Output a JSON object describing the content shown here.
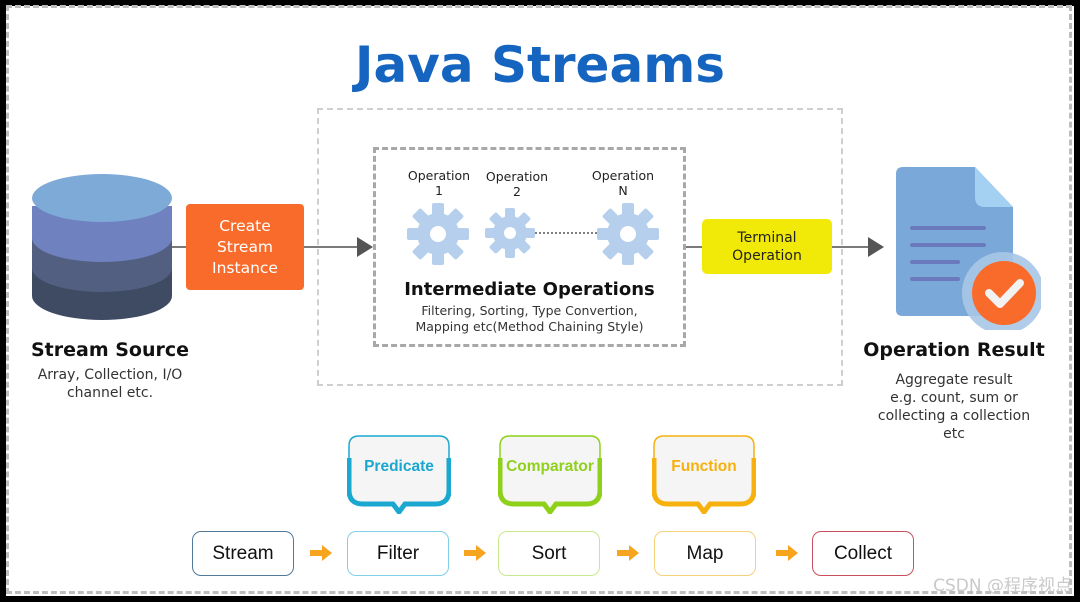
{
  "title": "Java Streams",
  "colors": {
    "title": "#1565c0",
    "create_box": "#f96b2a",
    "terminal_box": "#f1ea08",
    "gear": "#b5cfec",
    "predicate": "#1aa8d0",
    "comparator": "#8fd11a",
    "function": "#f7b10e",
    "collect_border": "#c9505e",
    "stream_border": "#4f7a9c",
    "flow_arrow": "#f7a51e"
  },
  "source": {
    "icon": "database-icon",
    "title": "Stream Source",
    "description_lines": [
      "Array, Collection, I/O",
      "channel etc."
    ]
  },
  "create": {
    "lines": [
      "Create",
      "Stream",
      "Instance"
    ]
  },
  "intermediate": {
    "operations": [
      {
        "line1": "Operation",
        "line2": "1",
        "icon": "gear-icon"
      },
      {
        "line1": "Operation",
        "line2": "2",
        "icon": "gear-icon"
      },
      {
        "line1": "Operation",
        "line2": "N",
        "icon": "gear-icon"
      }
    ],
    "title": "Intermediate Operations",
    "description_lines": [
      "Filtering, Sorting, Type Convertion,",
      "Mapping etc(Method Chaining Style)"
    ]
  },
  "terminal": {
    "lines": [
      "Terminal",
      "Operation"
    ]
  },
  "result": {
    "icon": "document-check-icon",
    "title": "Operation Result",
    "description_lines": [
      "Aggregate result",
      "e.g. count, sum or",
      "collecting a collection",
      "etc"
    ]
  },
  "pipeline": {
    "steps": [
      {
        "label": "Stream",
        "bubble": null
      },
      {
        "label": "Filter",
        "bubble": "Predicate"
      },
      {
        "label": "Sort",
        "bubble": "Comparator"
      },
      {
        "label": "Map",
        "bubble": "Function"
      },
      {
        "label": "Collect",
        "bubble": null
      }
    ]
  },
  "watermark": "CSDN @程序视点"
}
